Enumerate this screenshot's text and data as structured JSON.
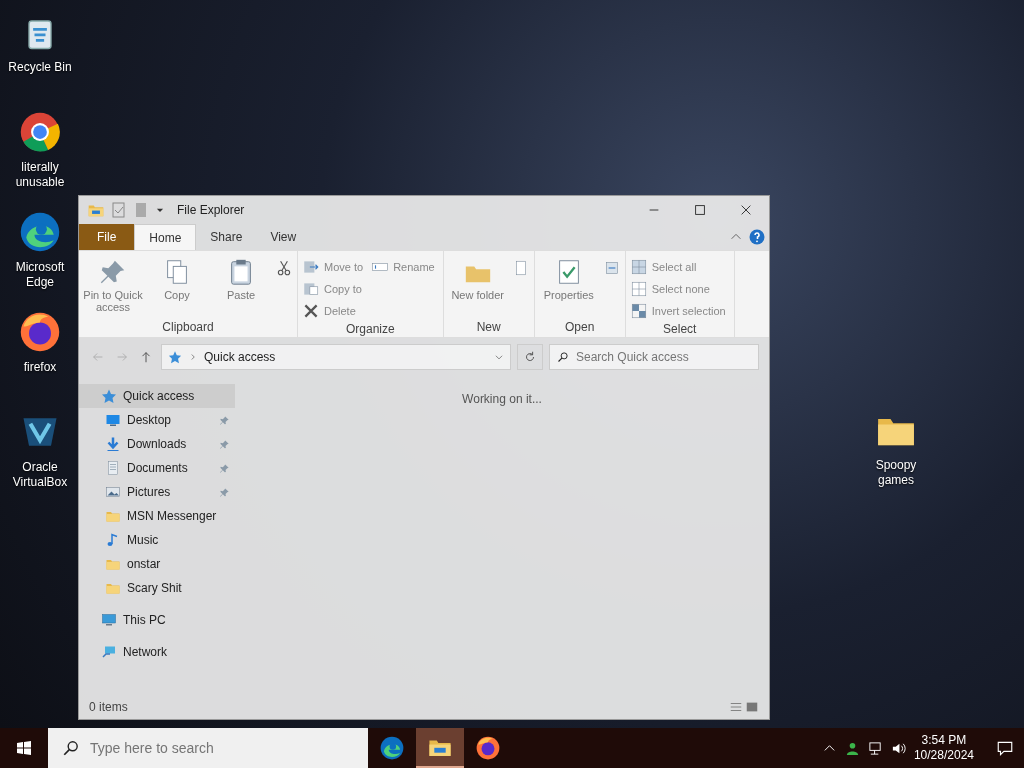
{
  "desktop": {
    "left_icons": [
      {
        "label": "Recycle Bin",
        "kind": "recycle"
      },
      {
        "label": "literally unusable",
        "kind": "chrome"
      },
      {
        "label": "Microsoft Edge",
        "kind": "edge"
      },
      {
        "label": "firefox",
        "kind": "firefox"
      },
      {
        "label": "Oracle VirtualBox",
        "kind": "vbox"
      }
    ],
    "right_icons": [
      {
        "label": "Spoopy games",
        "kind": "folder"
      }
    ]
  },
  "window": {
    "title": "File Explorer",
    "ribbon_tabs": [
      {
        "label": "File",
        "kind": "file",
        "selected": false
      },
      {
        "label": "Home",
        "kind": "tab",
        "selected": true
      },
      {
        "label": "Share",
        "kind": "tab",
        "selected": false
      },
      {
        "label": "View",
        "kind": "tab",
        "selected": false
      }
    ],
    "ribbon_groups": [
      {
        "label": "Clipboard",
        "buttons": [
          {
            "label": "Pin to Quick access",
            "kind": "large"
          },
          {
            "label": "Copy",
            "kind": "large"
          },
          {
            "label": "Paste",
            "kind": "large"
          },
          {
            "kind": "icon"
          }
        ]
      },
      {
        "label": "Organize",
        "buttons": [
          {
            "label": "Move to",
            "kind": "small"
          },
          {
            "label": "Copy to",
            "kind": "small"
          },
          {
            "label": "Delete",
            "kind": "small"
          },
          {
            "label": "Rename",
            "kind": "small"
          }
        ]
      },
      {
        "label": "New",
        "buttons": [
          {
            "label": "New folder",
            "kind": "large"
          },
          {
            "kind": "icon"
          }
        ]
      },
      {
        "label": "Open",
        "buttons": [
          {
            "label": "Properties",
            "kind": "large"
          },
          {
            "kind": "icon"
          }
        ]
      },
      {
        "label": "Select",
        "buttons": [
          {
            "label": "Select all",
            "kind": "small"
          },
          {
            "label": "Select none",
            "kind": "small"
          },
          {
            "label": "Invert selection",
            "kind": "small"
          }
        ]
      }
    ],
    "address": "Quick access",
    "search": {
      "placeholder": "Search Quick access"
    },
    "navigation": [
      {
        "label": "Quick access",
        "kind": "star",
        "selected": true,
        "children": [
          {
            "label": "Desktop",
            "kind": "desktop",
            "pinned": true,
            "selected": false
          },
          {
            "label": "Downloads",
            "kind": "download",
            "pinned": true,
            "selected": false
          },
          {
            "label": "Documents",
            "kind": "documents",
            "pinned": true,
            "selected": false
          },
          {
            "label": "Pictures",
            "kind": "pictures",
            "pinned": true,
            "selected": false
          },
          {
            "label": "MSN Messenger",
            "kind": "folder",
            "pinned": false,
            "selected": false
          },
          {
            "label": "Music",
            "kind": "music",
            "pinned": false,
            "selected": false
          },
          {
            "label": "onstar",
            "kind": "folder",
            "pinned": false,
            "selected": false
          },
          {
            "label": "Scary Shit",
            "kind": "folder",
            "pinned": false,
            "selected": false
          }
        ]
      },
      {
        "label": "This PC",
        "kind": "pc",
        "selected": false
      },
      {
        "label": "Network",
        "kind": "network",
        "selected": false
      }
    ],
    "content_message": "Working on it...",
    "status": "0 items"
  },
  "taskbar": {
    "search": {
      "placeholder": "Type here to search"
    },
    "apps": [
      {
        "kind": "edge",
        "active": false
      },
      {
        "kind": "explorer",
        "active": true
      },
      {
        "kind": "firefox",
        "active": false
      }
    ],
    "time": "3:54 PM",
    "date": "10/28/2024"
  }
}
